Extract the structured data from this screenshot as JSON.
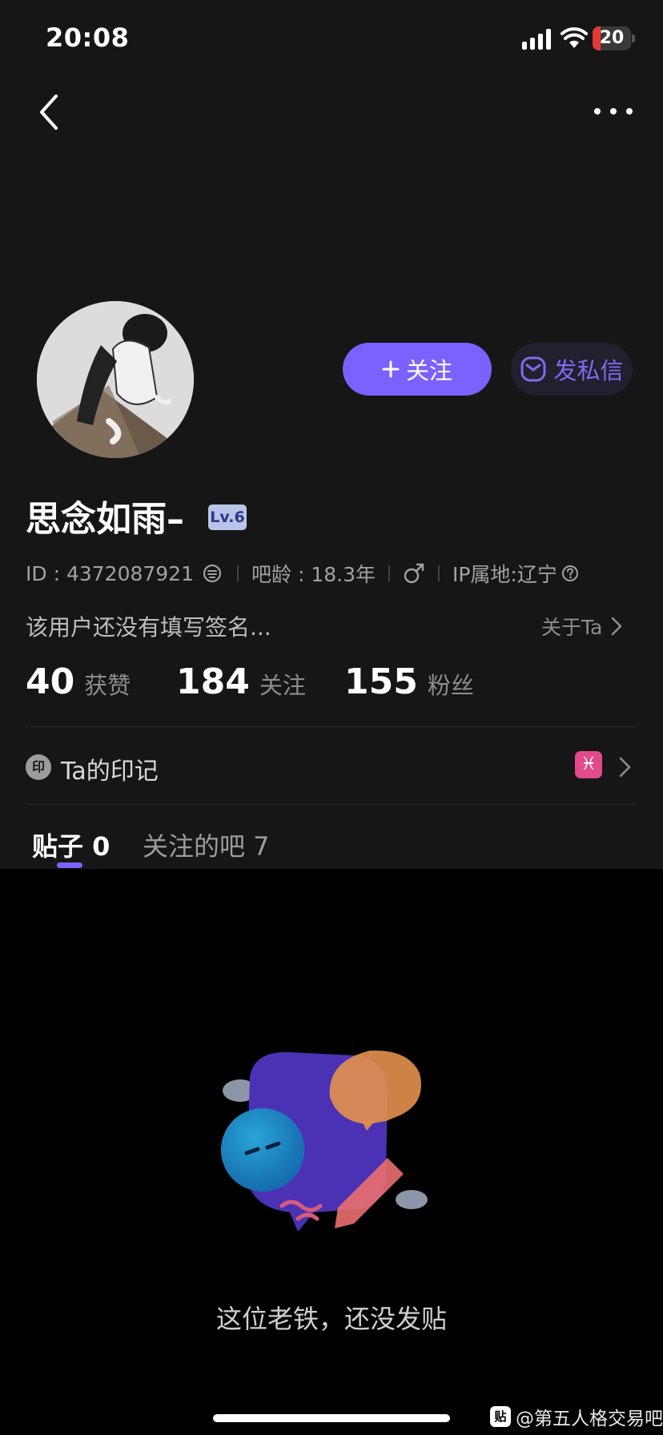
{
  "status_bar": {
    "time": "20:08",
    "battery": "20",
    "battery_level": 0.2
  },
  "profile": {
    "username": "思念如雨–",
    "level": "Lv.6",
    "id_text": "ID : 4372087921",
    "bar_age": "吧龄 : 18.3年",
    "ip_location": "IP属地:辽宁",
    "bio": "该用户还没有填写签名...",
    "about_label": "关于Ta",
    "follow_label": "关注",
    "dm_label": "发私信"
  },
  "stats": [
    {
      "value": "40",
      "label": "获赞"
    },
    {
      "value": "184",
      "label": "关注"
    },
    {
      "value": "155",
      "label": "粉丝"
    }
  ],
  "imprint": {
    "icon_text": "印",
    "label": "Ta的印记",
    "badge": "♓"
  },
  "tabs": [
    {
      "label": "贴子 0",
      "active": true
    },
    {
      "label": "关注的吧 7",
      "active": false
    }
  ],
  "empty_state": {
    "message": "这位老铁，还没发贴"
  },
  "watermark": {
    "logo": "贴",
    "text": "@第五人格交易吧"
  },
  "colors": {
    "accent": "#7b61ff",
    "background_top": "#161616",
    "background_content": "#000000",
    "battery_low": "#e53935"
  }
}
